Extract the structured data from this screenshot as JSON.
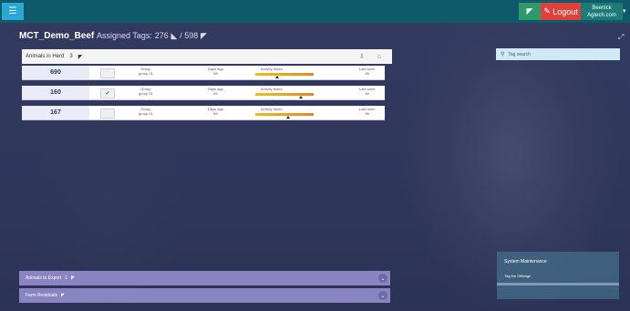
{
  "header": {
    "menu_icon": "menu-icon",
    "green_icon": "cattle-icon",
    "red_button_label": "Logout",
    "user_line1": "Beenick",
    "user_line2": "Agtech.com"
  },
  "title": {
    "farm_name": "MCT_Demo_Beef",
    "assigned_label": "Assigned Tags:",
    "assigned_value": "276",
    "total_value": "/ 598"
  },
  "animals_panel": {
    "label": "Animals in Herd",
    "count": "3",
    "rows": [
      {
        "id": "690",
        "checked": false,
        "group": "Group",
        "group_val": "group 01",
        "days": "Days ago",
        "days_val": "89",
        "activity": "Activity Index",
        "last": "Last seen",
        "last_val": "89"
      },
      {
        "id": "160",
        "checked": true,
        "group": "Group",
        "group_val": "group 01",
        "days": "Days ago",
        "days_val": "89",
        "activity": "Activity Index",
        "last": "Last seen",
        "last_val": "89"
      },
      {
        "id": "167",
        "checked": false,
        "group": "Group",
        "group_val": "group 01",
        "days": "Days ago",
        "days_val": "89",
        "activity": "Activity Index",
        "last": "Last seen",
        "last_val": "89"
      }
    ]
  },
  "search": {
    "placeholder": "Tag search"
  },
  "bottom_panels": {
    "export": {
      "label": "Animals to Export",
      "count": "1"
    },
    "remainder": {
      "label": "Farm Residuals"
    }
  },
  "system_box": {
    "title": "System Maintenance",
    "row": "Tag the Offstage"
  }
}
